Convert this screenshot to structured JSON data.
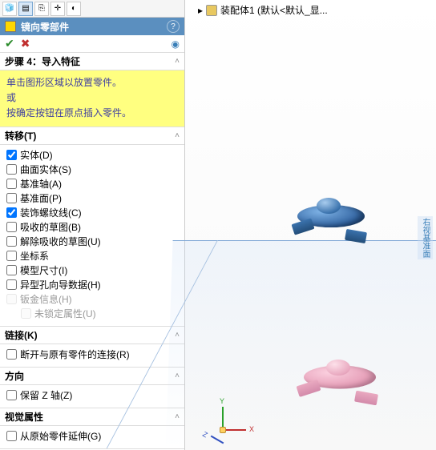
{
  "tabs": {
    "t1": "",
    "t2": "",
    "t3": "",
    "t4": "",
    "t5": ""
  },
  "title": "镜向零部件",
  "help": "?",
  "ok": "✔",
  "cancel": "✖",
  "pin": "◉",
  "step": {
    "head": "步骤 4：导入特征",
    "line1": "单击图形区域以放置零件。",
    "line2": "或",
    "line3": "按确定按钮在原点插入零件。"
  },
  "transfer": {
    "head": "转移(T)",
    "opts": [
      {
        "label": "实体(D)",
        "checked": true
      },
      {
        "label": "曲面实体(S)",
        "checked": false
      },
      {
        "label": "基准轴(A)",
        "checked": false
      },
      {
        "label": "基准面(P)",
        "checked": false
      },
      {
        "label": "装饰螺纹线(C)",
        "checked": true
      },
      {
        "label": "吸收的草图(B)",
        "checked": false
      },
      {
        "label": "解除吸收的草图(U)",
        "checked": false
      },
      {
        "label": "坐标系",
        "checked": false
      },
      {
        "label": "模型尺寸(I)",
        "checked": false
      },
      {
        "label": "异型孔向导数据(H)",
        "checked": false
      },
      {
        "label": "钣金信息(H)",
        "checked": false,
        "disabled": true
      }
    ],
    "sub": {
      "label": "未锁定属性(U)",
      "disabled": true
    }
  },
  "chain": {
    "head": "链接(K)",
    "opt": {
      "label": "断开与原有零件的连接(R)",
      "checked": false
    }
  },
  "dir": {
    "head": "方向",
    "opt": {
      "label": "保留 Z 轴(Z)",
      "checked": false
    }
  },
  "visual": {
    "head": "视觉属性",
    "opt": {
      "label": "从原始零件延伸(G)",
      "checked": false
    }
  },
  "breadcrumb": "装配体1 (默认<默认_显...",
  "axis_label": "右视基准面",
  "chev": "˄"
}
